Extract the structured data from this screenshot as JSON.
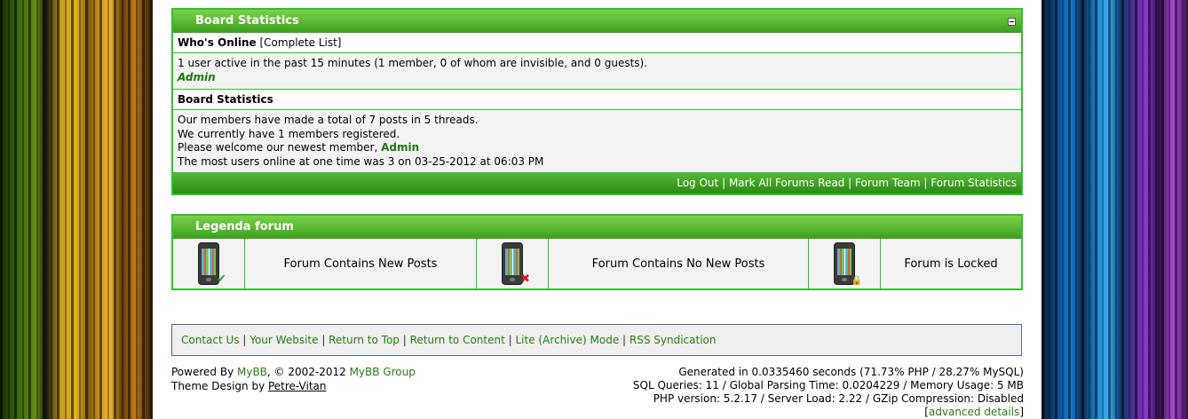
{
  "board_stats": {
    "header": "Board Statistics",
    "whos_online_label": "Who's Online",
    "complete_list_link": "[Complete List]",
    "active_text": "1 user active in the past 15 minutes (1 member, 0 of whom are invisible, and 0 guests).",
    "online_user": "Admin",
    "stats_header": "Board Statistics",
    "stats_line1": "Our members have made a total of 7 posts in 5 threads.",
    "stats_line2": "We currently have 1 members registered.",
    "stats_line3_prefix": "Please welcome our newest member, ",
    "newest_member": "Admin",
    "stats_line4": "The most users online at one time was 3 on 03-25-2012 at 06:03 PM",
    "footer_links": [
      "Log Out",
      "Mark All Forums Read",
      "Forum Team",
      "Forum Statistics"
    ],
    "separator": "|"
  },
  "legend": {
    "header": "Legenda forum",
    "items": [
      {
        "label": "Forum Contains New Posts",
        "icon": "phone-new-icon",
        "badge": "✔",
        "badge_color": "#2aa02a"
      },
      {
        "label": "Forum Contains No New Posts",
        "icon": "phone-nonew-icon",
        "badge": "✖",
        "badge_color": "#cc2222"
      },
      {
        "label": "Forum is Locked",
        "icon": "phone-locked-icon",
        "badge": "🔒",
        "badge_color": "#d4a020"
      }
    ]
  },
  "bottom_links": [
    "Contact Us",
    "Your Website",
    "Return to Top",
    "Return to Content",
    "Lite (Archive) Mode",
    "RSS Syndication"
  ],
  "copyright": {
    "powered_prefix": "Powered By ",
    "mybb": "MyBB",
    "years": ", © 2002-2012 ",
    "mybb_group": "MyBB Group",
    "theme_prefix": "Theme Design by ",
    "theme_author": "Petre-Vitan"
  },
  "debug": {
    "line1": "Generated in 0.0335460 seconds (71.73% PHP / 28.27% MySQL)",
    "line2": "SQL Queries: 11 / Global Parsing Time: 0.0204229 / Memory Usage: 5 MB",
    "line3": "PHP version: 5.2.17 / Server Load: 2.22 / GZip Compression: Disabled",
    "advanced": "advanced details"
  }
}
